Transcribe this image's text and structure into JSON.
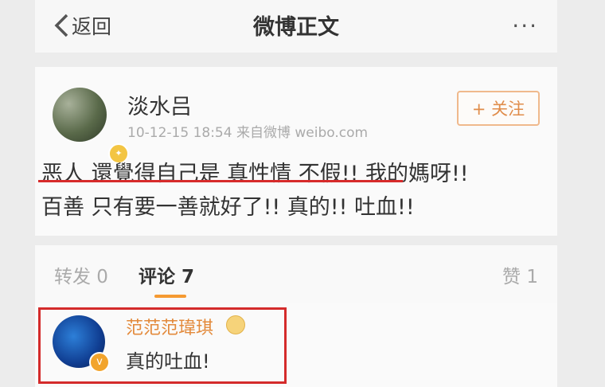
{
  "header": {
    "back_label": "返回",
    "title": "微博正文",
    "more_label": "···"
  },
  "post": {
    "username": "淡水吕",
    "meta": "10-12-15 18:54  来自微博 weibo.com",
    "follow_label": "+ 关注",
    "text_line1": "恶人 還覺得自己是 真性情   不假!! 我的媽呀!!",
    "text_line2": "百善  只有要一善就好了!! 真的!! 吐血!!",
    "underline_color": "#d72b2b"
  },
  "tabs": {
    "repost": "转发 0",
    "comment": "评论 7",
    "like": "赞 1",
    "accent": "#f59a32"
  },
  "comment": {
    "username": "范范范瑋琪",
    "text": "真的吐血!",
    "highlight_color": "#d42b2b"
  },
  "icons": [
    "chevron-left-icon",
    "more-icon",
    "verified-badge-icon",
    "medal-icon"
  ]
}
